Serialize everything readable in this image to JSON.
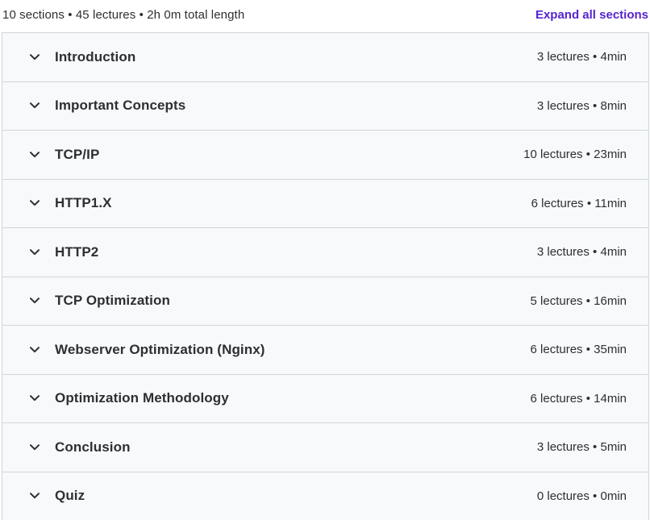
{
  "summary": {
    "text": "10 sections • 45 lectures • 2h 0m total length",
    "expand_all_label": "Expand all sections"
  },
  "sections": [
    {
      "title": "Introduction",
      "meta": "3 lectures • 4min"
    },
    {
      "title": "Important Concepts",
      "meta": "3 lectures • 8min"
    },
    {
      "title": "TCP/IP",
      "meta": "10 lectures • 23min"
    },
    {
      "title": "HTTP1.X",
      "meta": "6 lectures • 11min"
    },
    {
      "title": "HTTP2",
      "meta": "3 lectures • 4min"
    },
    {
      "title": "TCP Optimization",
      "meta": "5 lectures • 16min"
    },
    {
      "title": "Webserver Optimization (Nginx)",
      "meta": "6 lectures • 35min"
    },
    {
      "title": "Optimization Methodology",
      "meta": "6 lectures • 14min"
    },
    {
      "title": "Conclusion",
      "meta": "3 lectures • 5min"
    },
    {
      "title": "Quiz",
      "meta": "0 lectures • 0min"
    }
  ],
  "icons": {
    "section_toggle": "chevron-down-icon"
  },
  "colors": {
    "accent": "#5624d0",
    "text": "#2d2f31",
    "row_background": "#f7f9fa",
    "border": "#d1d7dc"
  }
}
